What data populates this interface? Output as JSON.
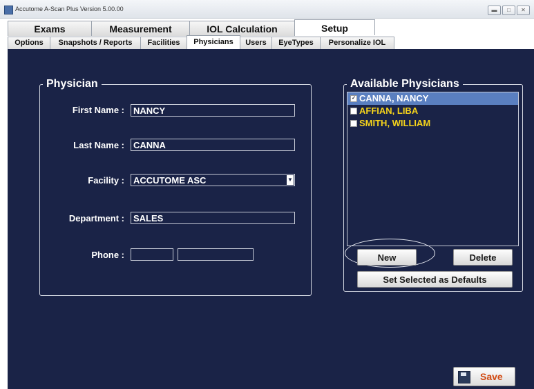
{
  "window": {
    "title": "Accutome A-Scan Plus Version 5.00.00"
  },
  "main_tabs": [
    {
      "label": "Exams"
    },
    {
      "label": "Measurement"
    },
    {
      "label": "IOL Calculation"
    },
    {
      "label": "Setup",
      "active": true
    }
  ],
  "sub_tabs": [
    {
      "label": "Options"
    },
    {
      "label": "Snapshots / Reports"
    },
    {
      "label": "Facilities"
    },
    {
      "label": "Physicians",
      "active": true
    },
    {
      "label": "Users"
    },
    {
      "label": "EyeTypes"
    },
    {
      "label": "Personalize IOL"
    }
  ],
  "physician_form": {
    "legend": "Physician",
    "first_name": {
      "label": "First Name :",
      "value": "NANCY"
    },
    "last_name": {
      "label": "Last Name :",
      "value": "CANNA"
    },
    "facility": {
      "label": "Facility :",
      "value": "ACCUTOME ASC"
    },
    "department": {
      "label": "Department :",
      "value": "SALES"
    },
    "phone": {
      "label": "Phone :",
      "value_area": "",
      "value_number": ""
    }
  },
  "available_physicians": {
    "legend": "Available Physicians",
    "items": [
      {
        "name": "CANNA, NANCY",
        "checked": true,
        "selected": true
      },
      {
        "name": "AFFIAN, LIBA",
        "checked": false
      },
      {
        "name": "SMITH, WILLIAM",
        "checked": false
      }
    ],
    "new_label": "New",
    "delete_label": "Delete",
    "defaults_label": "Set Selected as Defaults"
  },
  "save_label": "Save",
  "colors": {
    "panel_bg": "#1a2347",
    "list_text": "#f5d31b",
    "selected_row": "#5a7fc0",
    "save_text": "#d24a12"
  }
}
